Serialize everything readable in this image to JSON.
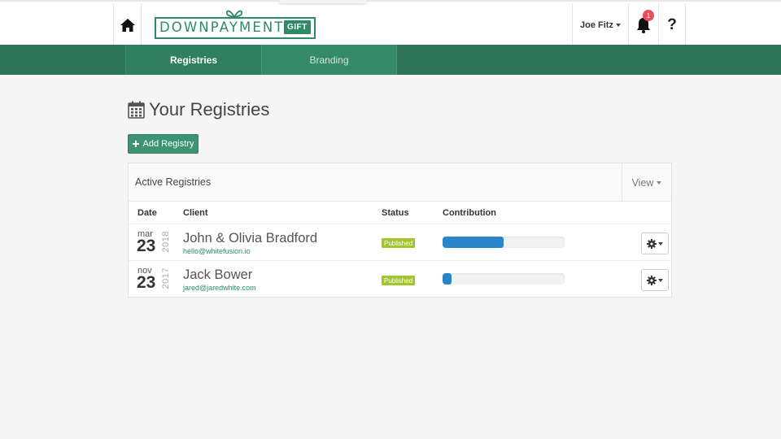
{
  "navbar": {
    "logo": {
      "main": "DOWNPAYMENT.",
      "gift": "GIFT"
    },
    "user_name": "Joe Fitz",
    "notification_count": "1",
    "help_label": "?"
  },
  "tabs": [
    {
      "label": "Registries",
      "active": true
    },
    {
      "label": "Branding",
      "active": false
    }
  ],
  "page": {
    "title": "Your Registries",
    "add_button": "Add Registry"
  },
  "panel": {
    "title": "Active Registries",
    "view_label": "View",
    "columns": [
      "Date",
      "Client",
      "Status",
      "Contribution"
    ],
    "rows": [
      {
        "month": "mar",
        "day": "23",
        "year": "2018",
        "client": "John & Olivia Bradford",
        "email": "hello@whitefusion.io",
        "status": "Published",
        "contribution": 0.5
      },
      {
        "month": "nov",
        "day": "23",
        "year": "2017",
        "client": "Jack Bower",
        "email": "jared@jaredwhite.com",
        "status": "Published",
        "contribution": 0.07
      }
    ]
  },
  "colors": {
    "brand_green": "#2f8a66",
    "nav_green": "#2e7458",
    "status_published": "#a3c52c",
    "progress_blue": "#2a84c8",
    "badge_red": "#e84e55"
  },
  "icons": [
    "home-icon",
    "bell-icon",
    "help-icon",
    "calendar-icon",
    "plus-icon",
    "gear-icon",
    "caret-down-icon",
    "gift-bow-icon"
  ]
}
